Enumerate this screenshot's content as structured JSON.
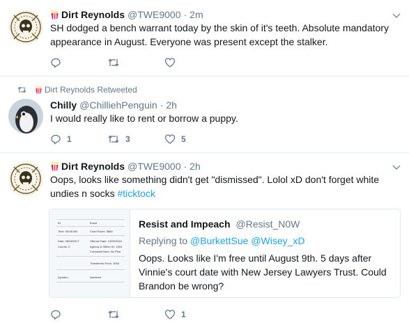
{
  "tweets": [
    {
      "name": "Dirt Reynolds",
      "handle": "@TWE9000",
      "time": "2m",
      "text": "SH dodged a bench warrant today by the skin of it's teeth. Absolute mandatory appearance in August. Everyone was present except the stalker.",
      "reply_count": "",
      "retweet_count": "",
      "like_count": ""
    },
    {
      "retweeted_by": "Dirt Reynolds Retweeted",
      "name": "Chilly",
      "handle": "@ChilliehPenguin",
      "time": "2h",
      "text": "I would really like to rent or borrow a puppy.",
      "reply_count": "1",
      "retweet_count": "3",
      "like_count": "5"
    },
    {
      "name": "Dirt Reynolds",
      "handle": "@TWE9000",
      "time": "2h",
      "text": "Oops, looks like something didn't get \"dismissed\". Lolol xD don't forget white undies n socks ",
      "hashtag": "#ticktock",
      "reply_count": "",
      "retweet_count": "",
      "like_count": "1"
    }
  ],
  "quote": {
    "name": "Resist and Impeach",
    "handle": "@Resist_N0W",
    "replying_prefix": "Replying to ",
    "replying_to_1": "@BurkettSue",
    "replying_to_2": "@Wisey_xD",
    "text": "Oops. Looks like I'm free until August 9th. 5 days after Vinnie's court date with New Jersey Lawyers Trust. Could Brandon be wrong?",
    "thumbnail_rows": [
      [
        "Time: 08:45 AM",
        "Court Room: 3880"
      ],
      [
        "Date: 08/08/2017",
        "Offense Date: 12/05/2016"
      ],
      [
        "Counts: 0",
        "Agency & Officer ID: 1604"
      ],
      [
        "",
        "Complaint Num: No Plea"
      ],
      [
        "",
        "Transferred From: 3004"
      ],
      [
        "Aymann:",
        "Nominee:"
      ]
    ],
    "thumbnail_head": [
      "ID",
      "Event"
    ]
  },
  "colors": {
    "border": "#e6ecf0",
    "muted": "#657786",
    "link": "#1da1f2",
    "text": "#14171a"
  }
}
